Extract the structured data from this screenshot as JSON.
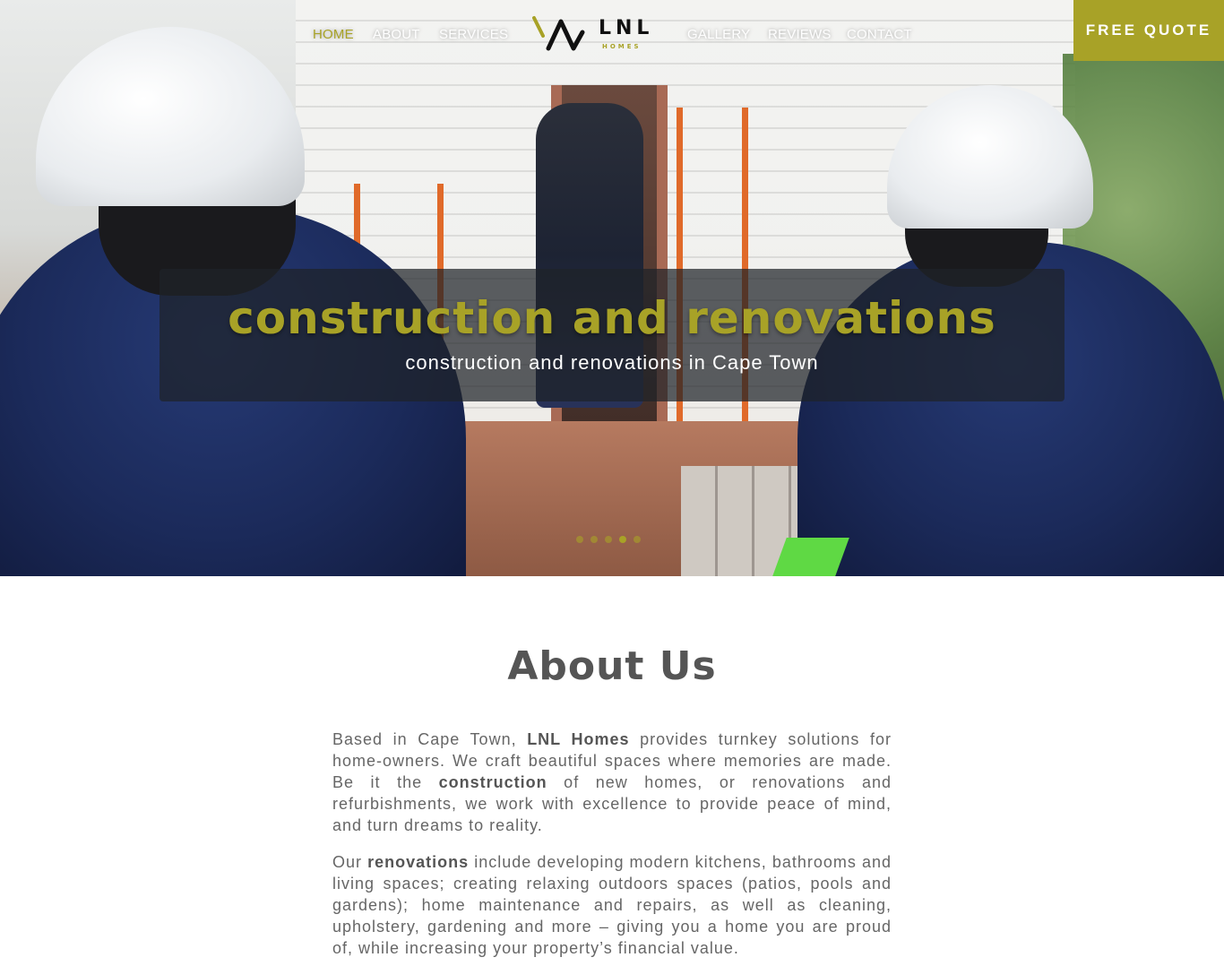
{
  "nav": {
    "left_items": [
      {
        "label": "HOME",
        "active": true
      },
      {
        "label": "ABOUT"
      },
      {
        "label": "SERVICES"
      }
    ],
    "right_items": [
      {
        "label": "GALLERY"
      },
      {
        "label": "REVIEWS"
      },
      {
        "label": "CONTACT"
      }
    ],
    "logo_text": "LNL",
    "logo_sub": "HOMES",
    "quote_button": "FREE QUOTE"
  },
  "hero": {
    "title": "construction and renovations",
    "subtitle": "construction and renovations in Cape Town",
    "slide_count": 5,
    "active_slide": 4
  },
  "about": {
    "heading": "About Us",
    "p1": {
      "a": "Based in Cape Town, ",
      "b1": "LNL Homes",
      "c": " provides turnkey solutions for home-owners. We craft beautiful spaces where memories are made. Be it the ",
      "b2": "construction",
      "d": " of new homes, or renovations and refurbishments, we work with excellence to provide peace of mind, and turn dreams to reality."
    },
    "p2": {
      "a": "Our ",
      "b1": "renovations",
      "c": " include developing modern kitchens, bathrooms and living spaces; creating relaxing outdoors spaces (patios, pools and gardens); home maintenance and repairs, as well as cleaning, upholstery, gardening and more – giving you a home you are proud of, while increasing your property’s financial value."
    }
  },
  "colors": {
    "accent": "#a8a227",
    "text": "#666666",
    "heading": "#555555"
  }
}
